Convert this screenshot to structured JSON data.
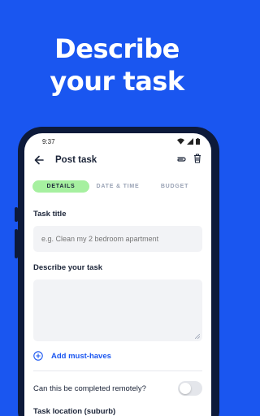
{
  "promo": {
    "line1": "Describe",
    "line2": "your task"
  },
  "status": {
    "time": "9:37"
  },
  "appbar": {
    "title": "Post task"
  },
  "tabs": [
    {
      "label": "DETAILS",
      "active": true
    },
    {
      "label": "DATE & TIME",
      "active": false
    },
    {
      "label": "BUDGET",
      "active": false
    }
  ],
  "form": {
    "task_title_label": "Task title",
    "task_title_placeholder": "e.g. Clean my 2 bedroom apartment",
    "describe_label": "Describe your task",
    "must_haves": "Add must-haves",
    "remote_question": "Can this be completed remotely?",
    "remote_enabled": false,
    "location_label": "Task location (suburb)"
  },
  "colors": {
    "brand_blue": "#1a56f0",
    "tab_active": "#a6f0a0",
    "text_dark": "#1b2438"
  }
}
